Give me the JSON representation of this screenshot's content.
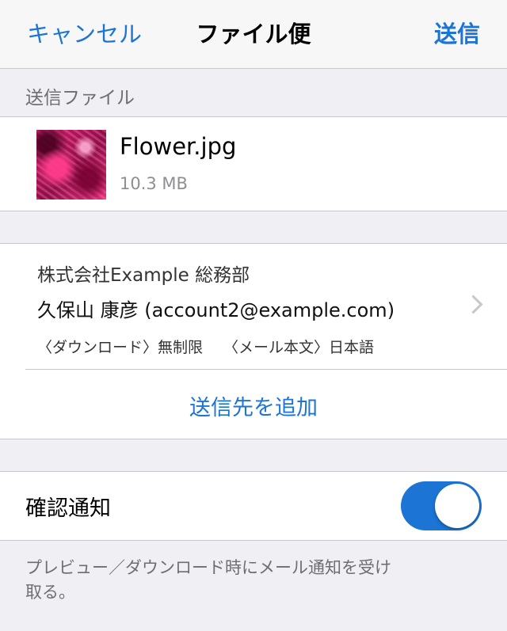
{
  "navbar": {
    "cancel_label": "キャンセル",
    "title": "ファイル便",
    "send_label": "送信"
  },
  "files_section": {
    "header": "送信ファイル",
    "file": {
      "name": "Flower.jpg",
      "size": "10.3 MB"
    }
  },
  "recipient": {
    "company": "株式会社Example 総務部",
    "name_email": "久保山 康彦 (account2@example.com)",
    "download_option": "〈ダウンロード〉無制限",
    "mail_body_option": "〈メール本文〉日本語",
    "add_label": "送信先を追加"
  },
  "notification": {
    "label": "確認通知",
    "enabled": true,
    "description": "プレビュー／ダウンロード時にメール通知を受け取る。"
  },
  "colors": {
    "accent": "#1c74d4",
    "background": "#efeff4"
  },
  "icons": {
    "thumbnail": "flower-thumbnail",
    "chevron": "chevron-right-icon"
  }
}
